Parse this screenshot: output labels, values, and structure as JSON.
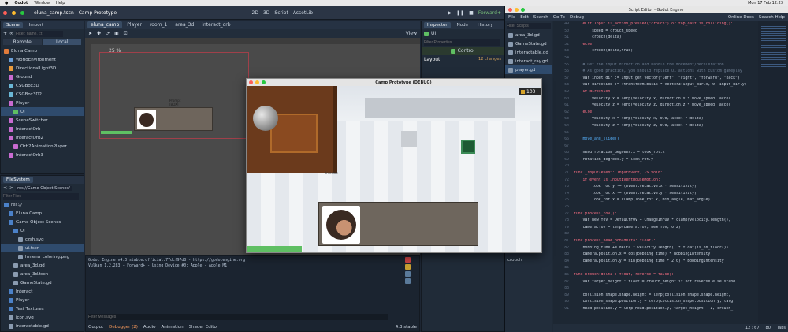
{
  "macbar": {
    "app": "Godot",
    "menus": [
      "Window",
      "Help"
    ],
    "clock": "Mon 17 Feb 12:23"
  },
  "godot_top": {
    "title": "eluna_camp.tscn - Camp Prototype",
    "modes": [
      "2D",
      "3D",
      "Script",
      "AssetLib"
    ],
    "renderer": "Forward+"
  },
  "scene_panel": {
    "tabs": [
      "Scene",
      "Import"
    ],
    "filter_placeholder": "Filter: name, t:t",
    "remote": "Remote",
    "local": "Local",
    "nodes": [
      {
        "label": "Eluna Camp",
        "depth": 0
      },
      {
        "label": "WorldEnvironment",
        "depth": 1
      },
      {
        "label": "DirectionalLight3D",
        "depth": 1
      },
      {
        "label": "Ground",
        "depth": 1
      },
      {
        "label": "CSGBox3D",
        "depth": 1
      },
      {
        "label": "CSGBox3D2",
        "depth": 1
      },
      {
        "label": "Player",
        "depth": 1
      },
      {
        "label": "UI",
        "depth": 2
      },
      {
        "label": "SceneSwitcher",
        "depth": 1
      },
      {
        "label": "InteractOrb",
        "depth": 1
      },
      {
        "label": "InteractOrb2",
        "depth": 1
      },
      {
        "label": "Orb2AnimationPlayer",
        "depth": 2
      },
      {
        "label": "InteractOrb3",
        "depth": 1
      }
    ]
  },
  "filesystem": {
    "title": "FileSystem",
    "path": "res://Game Object Scenes/",
    "filter_placeholder": "Filter Files",
    "items": [
      {
        "label": "res://",
        "depth": 0
      },
      {
        "label": "Eluna Camp",
        "depth": 1
      },
      {
        "label": "Game Object Scenes",
        "depth": 1
      },
      {
        "label": "UI",
        "depth": 2
      },
      {
        "label": "czsh.svg",
        "depth": 3
      },
      {
        "label": "ui.tscn",
        "depth": 3
      },
      {
        "label": "hmena_coloring.png",
        "depth": 3
      },
      {
        "label": "area_3d.gd",
        "depth": 2
      },
      {
        "label": "area_3d.tscn",
        "depth": 2
      },
      {
        "label": "GameState.gd",
        "depth": 2
      },
      {
        "label": "Interact",
        "depth": 1
      },
      {
        "label": "Player",
        "depth": 1
      },
      {
        "label": "Test Textures",
        "depth": 1
      },
      {
        "label": "icon.svg",
        "depth": 1
      },
      {
        "label": "interactable.gd",
        "depth": 1
      }
    ]
  },
  "editor_tabs": [
    "eluna_camp",
    "Player",
    "room_1",
    "area_3d",
    "interact_orb"
  ],
  "viewport": {
    "view_label": "View",
    "zoom": "25 %",
    "prompt": "Prompt",
    "prompt_sub": "[BOX]"
  },
  "output": {
    "lines": [
      "Godot Engine v4.3.stable.official.77dcf97d8 - https://godotengine.org",
      "Vulkan 1.2.283 - Forward+ - Using Device #0: Apple - Apple M1"
    ],
    "filter": "Filter Messages",
    "bottom_tabs": [
      "Output",
      "Debugger (2)",
      "Audio",
      "Animation",
      "Shader Editor"
    ],
    "version": "4.3.stable"
  },
  "inspector": {
    "tabs": [
      "Inspector",
      "Node",
      "History"
    ],
    "node": "UI",
    "filter": "Filter Properties",
    "section": "Control",
    "changes": "12 changes",
    "sub": "Layout"
  },
  "game_window": {
    "title": "Camp Prototype (DEBUG)",
    "score": "100",
    "tooltip": "Interact"
  },
  "script_editor": {
    "title": "Script Editor - Godot Engine",
    "menu": [
      "File",
      "Edit",
      "Search",
      "Go To",
      "Debug"
    ],
    "right": [
      "Online Docs",
      "Search Help"
    ],
    "filter": "Filter Scripts",
    "scripts": [
      "area_3d.gd",
      "GameState.gd",
      "interactable.gd",
      "interact_ray.gd",
      "player.gd"
    ],
    "methods_label": "crouch",
    "status": "12 : 67",
    "status2": "Tabs",
    "status3": "80",
    "lines": [
      {
        "n": "49",
        "t": "    elif Input.is_action_pressed(\"crouch\") or top_cast.is_colliding():",
        "c": "kw"
      },
      {
        "n": "50",
        "t": "        speed = crouch_speed",
        "c": ""
      },
      {
        "n": "51",
        "t": "        crouch(delta)",
        "c": ""
      },
      {
        "n": "52",
        "t": "    else:",
        "c": "kw"
      },
      {
        "n": "53",
        "t": "        crouch(delta,true)",
        "c": ""
      },
      {
        "n": "54",
        "t": "",
        "c": ""
      },
      {
        "n": "55",
        "t": "    # Get the input direction and handle the movement/deceleration.",
        "c": "cm"
      },
      {
        "n": "56",
        "t": "    # As good practice, you should replace UI actions with custom gameplay",
        "c": "cm"
      },
      {
        "n": "57",
        "t": "    var input_dir := Input.get_vector(\"left\", \"right\", \"forward\", \"back\")",
        "c": ""
      },
      {
        "n": "58",
        "t": "    var direction := (transform.basis * Vector3(input_dir.x, 0, input_dir.y)",
        "c": ""
      },
      {
        "n": "59",
        "t": "    if direction:",
        "c": "kw"
      },
      {
        "n": "60",
        "t": "        velocity.x = lerp(velocity.x, direction.x * move_speed, accel",
        "c": ""
      },
      {
        "n": "61",
        "t": "        velocity.z = lerp(velocity.z, direction.z * move_speed, accel",
        "c": ""
      },
      {
        "n": "62",
        "t": "    else:",
        "c": "kw"
      },
      {
        "n": "63",
        "t": "        velocity.x = lerp(velocity.x, 0.0, accel * delta)",
        "c": ""
      },
      {
        "n": "64",
        "t": "        velocity.z = lerp(velocity.z, 0.0, accel * delta)",
        "c": ""
      },
      {
        "n": "65",
        "t": "",
        "c": ""
      },
      {
        "n": "66",
        "t": "    move_and_slide()",
        "c": "fn"
      },
      {
        "n": "67",
        "t": "",
        "c": ""
      },
      {
        "n": "68",
        "t": "    head.rotation_degrees.x = look_rot.x",
        "c": ""
      },
      {
        "n": "69",
        "t": "    rotation_degrees.y = look_rot.y",
        "c": ""
      },
      {
        "n": "70",
        "t": "",
        "c": ""
      },
      {
        "n": "71",
        "t": "func _input(event: InputEvent) -> void:",
        "c": "kw"
      },
      {
        "n": "72",
        "t": "    if event is InputEventMouseMotion:",
        "c": "kw"
      },
      {
        "n": "73",
        "t": "        look_rot.y -= (event.relative.x * sensitivity)",
        "c": ""
      },
      {
        "n": "74",
        "t": "        look_rot.x -= (event.relative.y * sensitivity)",
        "c": ""
      },
      {
        "n": "75",
        "t": "        look_rot.x = clamp(look_rot.x, min_angle, max_angle)",
        "c": ""
      },
      {
        "n": "76",
        "t": "",
        "c": ""
      },
      {
        "n": "77",
        "t": "func process_fov():",
        "c": "kw"
      },
      {
        "n": "78",
        "t": "    var new_fov = DefaultFOV + ChangeInFOV * clamp(velocity.length(),",
        "c": ""
      },
      {
        "n": "79",
        "t": "    camera.fov = lerp(camera.fov, new_fov, 0.2)",
        "c": ""
      },
      {
        "n": "80",
        "t": "",
        "c": ""
      },
      {
        "n": "81",
        "t": "func process_head_bob(delta: float):",
        "c": "kw"
      },
      {
        "n": "82",
        "t": "    bobbing_time += delta * velocity.length() * float(is_on_floor())",
        "c": ""
      },
      {
        "n": "83",
        "t": "    camera.position.x = cos(bobbing_time) * BobbingIntensity",
        "c": ""
      },
      {
        "n": "84",
        "t": "    camera.position.y = sin(bobbing_time * 2.0) * BobbingIntensity",
        "c": ""
      },
      {
        "n": "85",
        "t": "",
        "c": ""
      },
      {
        "n": "86",
        "t": "func crouch(delta : float, reverse = false):",
        "c": "kw"
      },
      {
        "n": "87",
        "t": "    var target_height : float = crouch_height if not reverse else stand",
        "c": ""
      },
      {
        "n": "88",
        "t": "",
        "c": ""
      },
      {
        "n": "89",
        "t": "    collision_shape.shape.height = lerp(collision_shape.shape.height,",
        "c": ""
      },
      {
        "n": "90",
        "t": "    collision_shape.position.y = lerp(collision_shape.position.y, targ",
        "c": ""
      },
      {
        "n": "91",
        "t": "    head.position.y = lerp(head.position.y, target_height - 1, crouch_",
        "c": ""
      }
    ]
  },
  "colors": {
    "accent": "#4b81c8",
    "bg": "#1d2633",
    "panel": "#202b38",
    "green": "#5fbf63"
  }
}
